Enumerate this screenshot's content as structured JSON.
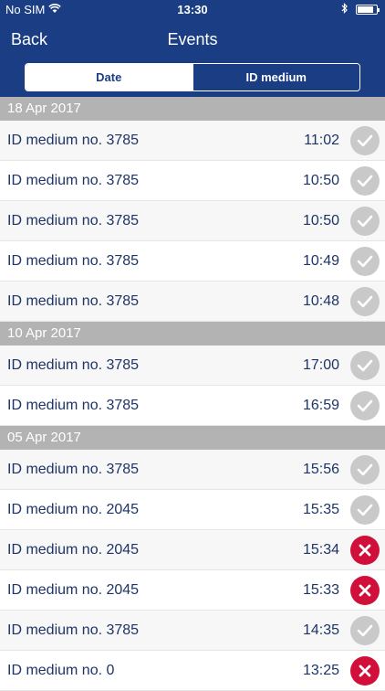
{
  "status_bar": {
    "carrier": "No SIM",
    "time": "13:30",
    "battery_level": 0.85
  },
  "nav": {
    "back_label": "Back",
    "title": "Events"
  },
  "segments": [
    {
      "label": "Date",
      "active": true
    },
    {
      "label": "ID medium",
      "active": false
    }
  ],
  "sections": [
    {
      "date": "18 Apr 2017",
      "rows": [
        {
          "label": "ID medium no. 3785",
          "time": "11:02",
          "status": "ok"
        },
        {
          "label": "ID medium no. 3785",
          "time": "10:50",
          "status": "ok"
        },
        {
          "label": "ID medium no. 3785",
          "time": "10:50",
          "status": "ok"
        },
        {
          "label": "ID medium no. 3785",
          "time": "10:49",
          "status": "ok"
        },
        {
          "label": "ID medium no. 3785",
          "time": "10:48",
          "status": "ok"
        }
      ]
    },
    {
      "date": "10 Apr 2017",
      "rows": [
        {
          "label": "ID medium no. 3785",
          "time": "17:00",
          "status": "ok"
        },
        {
          "label": "ID medium no. 3785",
          "time": "16:59",
          "status": "ok"
        }
      ]
    },
    {
      "date": "05 Apr 2017",
      "rows": [
        {
          "label": "ID medium no. 3785",
          "time": "15:56",
          "status": "ok"
        },
        {
          "label": "ID medium no. 2045",
          "time": "15:35",
          "status": "ok"
        },
        {
          "label": "ID medium no. 2045",
          "time": "15:34",
          "status": "fail"
        },
        {
          "label": "ID medium no. 2045",
          "time": "15:33",
          "status": "fail"
        },
        {
          "label": "ID medium no. 3785",
          "time": "14:35",
          "status": "ok"
        },
        {
          "label": "ID medium no. 0",
          "time": "13:25",
          "status": "fail"
        }
      ]
    }
  ],
  "colors": {
    "nav_bg": "#1b3d84",
    "section_bg": "#b3b3b3",
    "ok_icon": "#c9c9c9",
    "fail_icon": "#d0103a",
    "text": "#1e3467"
  }
}
